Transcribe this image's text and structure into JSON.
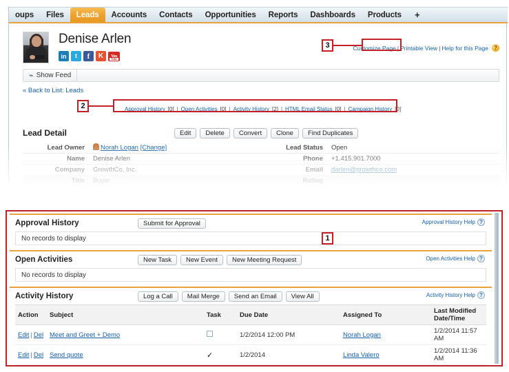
{
  "nav": {
    "tabs": [
      {
        "label": "oups",
        "active": false
      },
      {
        "label": "Files",
        "active": false
      },
      {
        "label": "Leads",
        "active": true
      },
      {
        "label": "Accounts",
        "active": false
      },
      {
        "label": "Contacts",
        "active": false
      },
      {
        "label": "Opportunities",
        "active": false
      },
      {
        "label": "Reports",
        "active": false
      },
      {
        "label": "Dashboards",
        "active": false
      },
      {
        "label": "Products",
        "active": false
      }
    ],
    "plus_label": "+"
  },
  "record": {
    "name": "Denise Arlen",
    "social_icons": [
      {
        "name": "linkedin-icon",
        "glyph": "in"
      },
      {
        "name": "twitter-icon",
        "glyph": "t"
      },
      {
        "name": "facebook-icon",
        "glyph": "f"
      },
      {
        "name": "klout-icon",
        "glyph": "K"
      },
      {
        "name": "youtube-icon",
        "glyph": "You"
      }
    ],
    "show_feed_label": "Show Feed",
    "back_to_list_label": "« Back to List: Leads"
  },
  "page_links": {
    "customize": "Customize Page",
    "printable": "Printable View",
    "help": "Help for this Page",
    "sep": "|",
    "help_orb": "?"
  },
  "quick_links": [
    {
      "label": "Approval History",
      "count": "[0]"
    },
    {
      "label": "Open Activities",
      "count": "[0]"
    },
    {
      "label": "Activity History",
      "count": "[2]"
    },
    {
      "label": "HTML Email Status",
      "count": "[0]"
    },
    {
      "label": "Campaign History",
      "count": "[0]"
    }
  ],
  "lead_detail": {
    "title": "Lead Detail",
    "buttons": [
      "Edit",
      "Delete",
      "Convert",
      "Clone",
      "Find Duplicates"
    ],
    "rows": [
      {
        "left_label": "Lead Owner",
        "left_value": "Norah Logan",
        "left_extra": "[Change]",
        "left_link": true,
        "left_icon": true,
        "right_label": "Lead Status",
        "right_value": "Open",
        "right_link": false
      },
      {
        "left_label": "Name",
        "left_value": "Denise Arlen",
        "left_extra": "",
        "left_link": false,
        "left_icon": false,
        "right_label": "Phone",
        "right_value": "+1.415.901.7000",
        "right_link": false
      },
      {
        "left_label": "Company",
        "left_value": "GrowthCo, Inc.",
        "left_extra": "",
        "left_link": false,
        "left_icon": false,
        "right_label": "Email",
        "right_value": "darlen@growthco.com",
        "right_link": true
      },
      {
        "left_label": "Title",
        "left_value": "Buyer",
        "left_extra": "",
        "left_link": false,
        "left_icon": false,
        "right_label": "Rating",
        "right_value": "",
        "right_link": false
      }
    ]
  },
  "markers": {
    "one": "1",
    "two": "2",
    "three": "3"
  },
  "related_lists": {
    "approval_history": {
      "title": "Approval History",
      "buttons": [
        "Submit for Approval"
      ],
      "help_label": "Approval History Help",
      "empty_text": "No records to display"
    },
    "open_activities": {
      "title": "Open Activities",
      "buttons": [
        "New Task",
        "New Event",
        "New Meeting Request"
      ],
      "help_label": "Open Activities Help",
      "empty_text": "No records to display"
    },
    "activity_history": {
      "title": "Activity History",
      "buttons": [
        "Log a Call",
        "Mail Merge",
        "Send an Email",
        "View All"
      ],
      "help_label": "Activity History Help",
      "columns": [
        "Action",
        "Subject",
        "Task",
        "Due Date",
        "Assigned To",
        "Last Modified Date/Time"
      ],
      "rows": [
        {
          "edit": "Edit",
          "sep": "|",
          "del": "Del",
          "subject": "Meet and Greet + Demo",
          "task_checked": false,
          "due_date": "1/2/2014 12:00 PM",
          "assigned_to": "Norah Logan",
          "last_modified": "1/2/2014 11:57 AM"
        },
        {
          "edit": "Edit",
          "sep": "|",
          "del": "Del",
          "subject": "Send quote",
          "task_checked": true,
          "due_date": "1/2/2014",
          "assigned_to": "Linda Valero",
          "last_modified": "1/2/2014 11:36 AM"
        }
      ],
      "check_glyph": "✓"
    }
  },
  "colors": {
    "accent_orange": "#e8a33d",
    "active_tab": "#eda12c",
    "link_blue": "#1560a8",
    "annotation_red": "#c02026"
  }
}
